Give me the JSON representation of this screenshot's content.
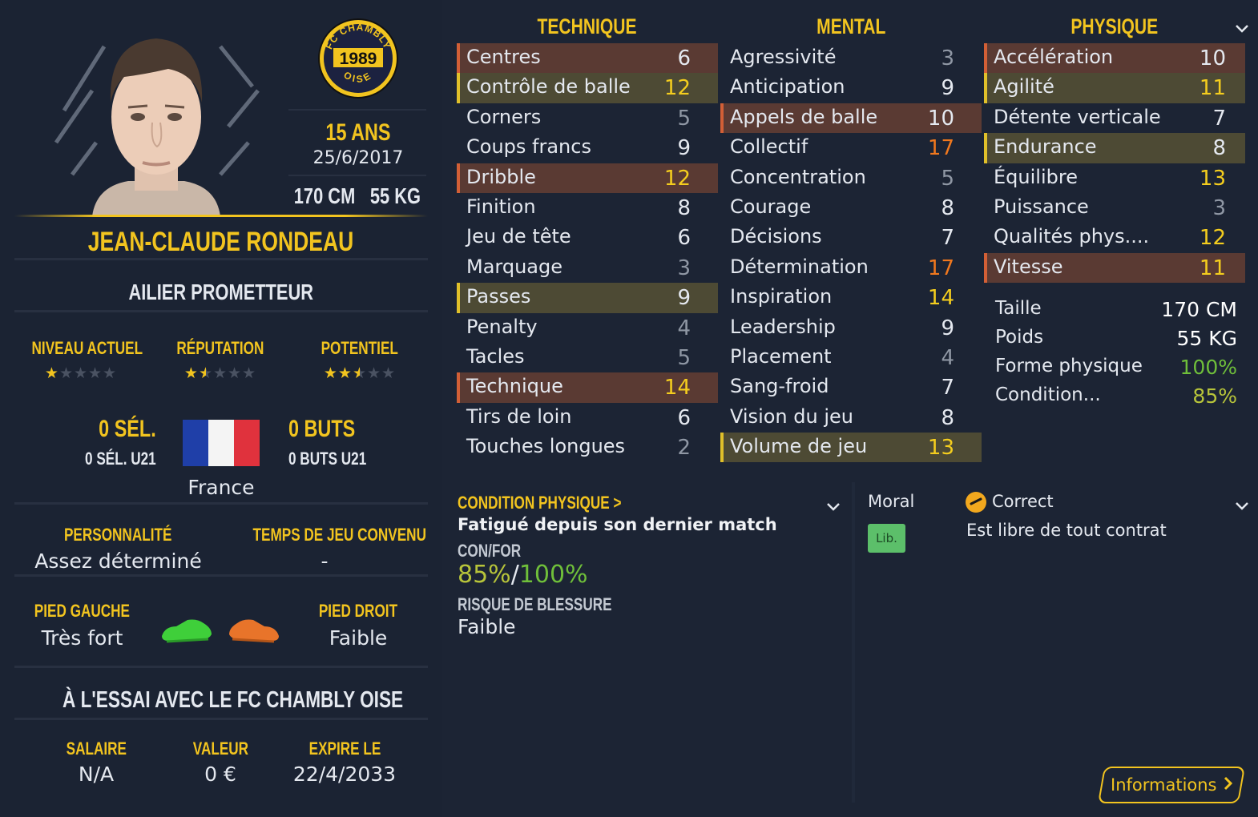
{
  "club": {
    "crest_top": "FC CHAMBLY",
    "crest_year": "1989",
    "crest_bottom": "OISE"
  },
  "player": {
    "age": "15 ANS",
    "dob": "25/6/2017",
    "height": "170 CM",
    "weight": "55 KG",
    "name": "JEAN-CLAUDE RONDEAU",
    "role": "AILIER PROMETTEUR",
    "ratings": [
      {
        "label": "NIVEAU ACTUEL",
        "stars": 1
      },
      {
        "label": "RÉPUTATION",
        "stars": 1.5
      },
      {
        "label": "POTENTIEL",
        "stars": 2.5
      }
    ],
    "caps": "0 SÉL.",
    "caps_u21": "0 SÉL. U21",
    "goals": "0 BUTS",
    "goals_u21": "0 BUTS U21",
    "nation": "France",
    "personality_label": "PERSONNALITÉ",
    "personality": "Assez déterminé",
    "playtime_label": "TEMPS DE JEU CONVENU",
    "playtime": "-",
    "left_foot_label": "PIED GAUCHE",
    "left_foot": "Très fort",
    "right_foot_label": "PIED DROIT",
    "right_foot": "Faible",
    "trial": "À L'ESSAI AVEC LE FC CHAMBLY OISE",
    "contract": [
      {
        "label": "SALAIRE",
        "value": "N/A"
      },
      {
        "label": "VALEUR",
        "value": "0 €"
      },
      {
        "label": "EXPIRE LE",
        "value": "22/4/2033"
      }
    ]
  },
  "attributes": {
    "technique": {
      "title": "TECHNIQUE",
      "items": [
        {
          "name": "Centres",
          "value": "6",
          "hl": "red"
        },
        {
          "name": "Contrôle de balle",
          "value": "12",
          "hl": "yel"
        },
        {
          "name": "Corners",
          "value": "5",
          "hl": ""
        },
        {
          "name": "Coups francs",
          "value": "9",
          "hl": ""
        },
        {
          "name": "Dribble",
          "value": "12",
          "hl": "red"
        },
        {
          "name": "Finition",
          "value": "8",
          "hl": ""
        },
        {
          "name": "Jeu de tête",
          "value": "6",
          "hl": ""
        },
        {
          "name": "Marquage",
          "value": "3",
          "hl": ""
        },
        {
          "name": "Passes",
          "value": "9",
          "hl": "yel"
        },
        {
          "name": "Penalty",
          "value": "4",
          "hl": ""
        },
        {
          "name": "Tacles",
          "value": "5",
          "hl": ""
        },
        {
          "name": "Technique",
          "value": "14",
          "hl": "red"
        },
        {
          "name": "Tirs de loin",
          "value": "6",
          "hl": ""
        },
        {
          "name": "Touches longues",
          "value": "2",
          "hl": ""
        }
      ]
    },
    "mental": {
      "title": "MENTAL",
      "items": [
        {
          "name": "Agressivité",
          "value": "3",
          "hl": ""
        },
        {
          "name": "Anticipation",
          "value": "9",
          "hl": ""
        },
        {
          "name": "Appels de balle",
          "value": "10",
          "hl": "red"
        },
        {
          "name": "Collectif",
          "value": "17",
          "hl": ""
        },
        {
          "name": "Concentration",
          "value": "5",
          "hl": ""
        },
        {
          "name": "Courage",
          "value": "8",
          "hl": ""
        },
        {
          "name": "Décisions",
          "value": "7",
          "hl": ""
        },
        {
          "name": "Détermination",
          "value": "17",
          "hl": ""
        },
        {
          "name": "Inspiration",
          "value": "14",
          "hl": ""
        },
        {
          "name": "Leadership",
          "value": "9",
          "hl": ""
        },
        {
          "name": "Placement",
          "value": "4",
          "hl": ""
        },
        {
          "name": "Sang-froid",
          "value": "7",
          "hl": ""
        },
        {
          "name": "Vision du jeu",
          "value": "8",
          "hl": ""
        },
        {
          "name": "Volume de jeu",
          "value": "13",
          "hl": "yel"
        }
      ]
    },
    "physique": {
      "title": "PHYSIQUE",
      "items": [
        {
          "name": "Accélération",
          "value": "10",
          "hl": "red"
        },
        {
          "name": "Agilité",
          "value": "11",
          "hl": "yel"
        },
        {
          "name": "Détente verticale",
          "value": "7",
          "hl": ""
        },
        {
          "name": "Endurance",
          "value": "8",
          "hl": "yel"
        },
        {
          "name": "Équilibre",
          "value": "13",
          "hl": ""
        },
        {
          "name": "Puissance",
          "value": "3",
          "hl": ""
        },
        {
          "name": "Qualités phys....",
          "value": "12",
          "hl": ""
        },
        {
          "name": "Vitesse",
          "value": "11",
          "hl": "red"
        }
      ]
    }
  },
  "body": [
    {
      "label": "Taille",
      "value": "170 CM",
      "color": "#ffffff"
    },
    {
      "label": "Poids",
      "value": "55 KG",
      "color": "#ffffff"
    },
    {
      "label": "Forme physique",
      "value": "100%",
      "color": "#6fbf3a"
    },
    {
      "label": "Condition...",
      "value": "85%",
      "color": "#b7c43a"
    }
  ],
  "condition": {
    "header": "CONDITION PHYSIQUE >",
    "status": "Fatigué depuis son dernier match",
    "confor_label": "CON/FOR",
    "con": "85%",
    "sep": "/",
    "for": "100%",
    "risk_label": "RISQUE DE BLESSURE",
    "risk": "Faible"
  },
  "moral": {
    "label": "Moral",
    "badge": "Lib.",
    "status": "Correct",
    "contract_status": "Est libre de tout contrat"
  },
  "info_button": "Informations",
  "colors": {
    "accent": "#f2c41f",
    "bg": "#1b2333",
    "value_low": "#8f97a4",
    "value_mid": "#e4e8ef",
    "value_high": "#f4cd1e",
    "value_top": "#f0781e"
  }
}
